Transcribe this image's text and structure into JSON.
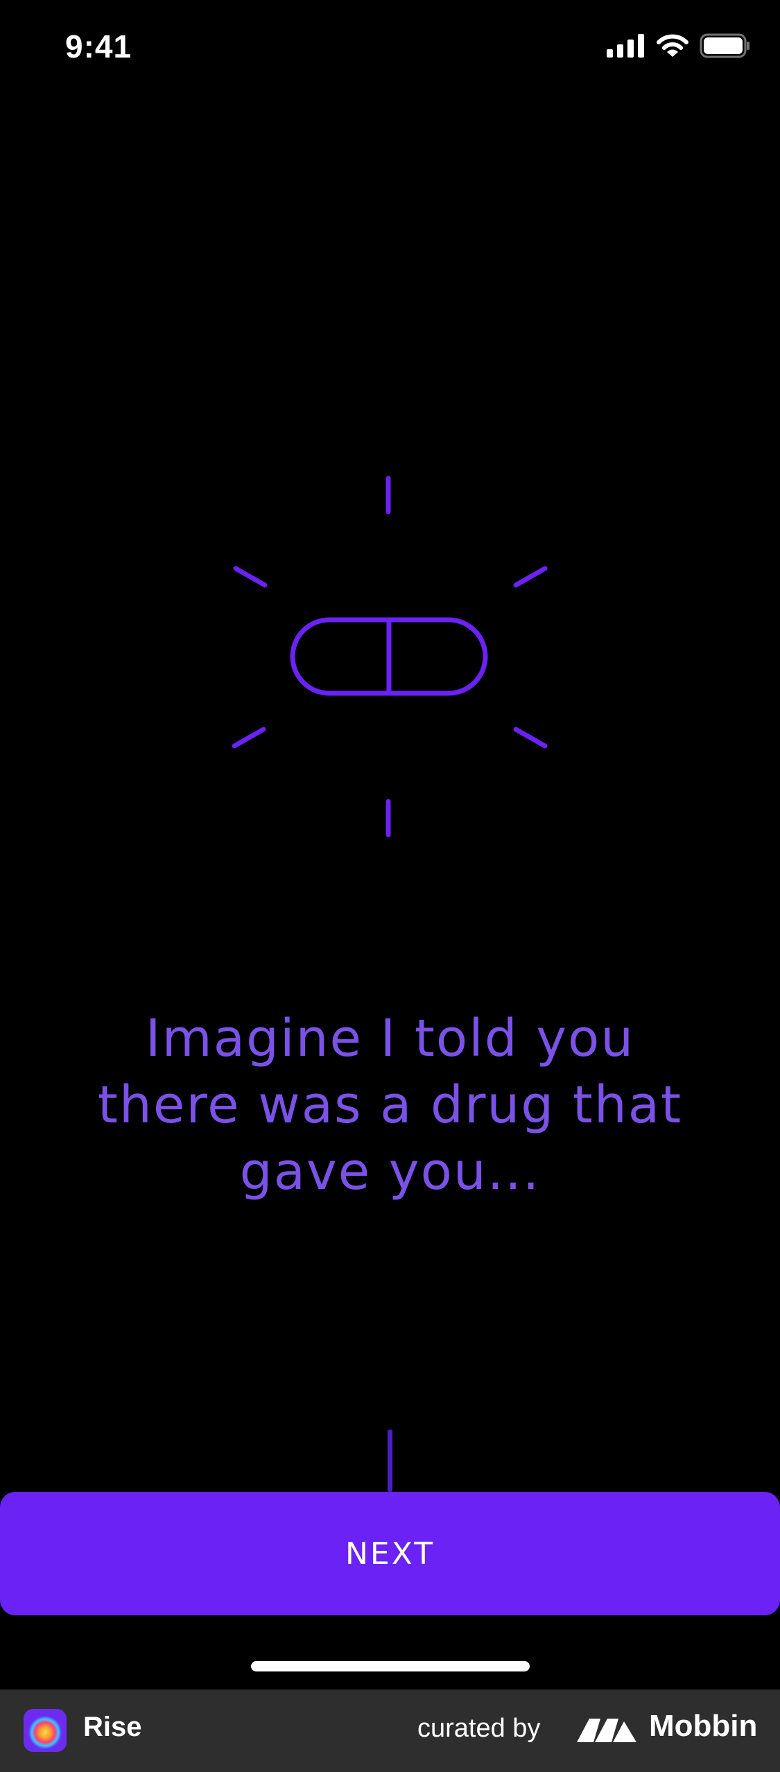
{
  "status_bar": {
    "time": "9:41",
    "icons": [
      "cellular-signal-icon",
      "wifi-icon",
      "battery-icon"
    ]
  },
  "hero": {
    "icon": "pill-icon",
    "accent_color": "#6a22f5"
  },
  "message": {
    "lines": [
      "Imagine I told you",
      "there was a drug that",
      "gave you..."
    ]
  },
  "actions": {
    "next_label": "NEXT",
    "button_color": "#6a22f5"
  },
  "footer": {
    "app_name": "Rise",
    "curated_by": "curated by",
    "brand": "Mobbin"
  }
}
